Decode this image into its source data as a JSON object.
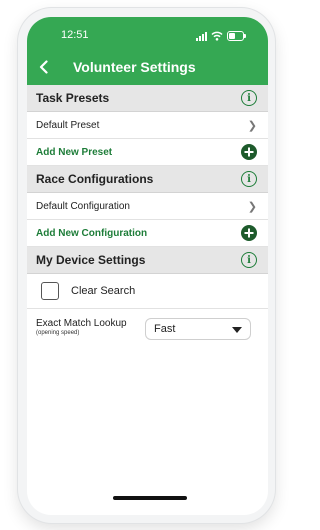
{
  "status_bar": {
    "time": "12:51"
  },
  "nav": {
    "title": "Volunteer Settings"
  },
  "task_presets": {
    "title": "Task Presets",
    "items": [
      {
        "label": "Default Preset"
      }
    ],
    "add_label": "Add New Preset"
  },
  "race_configurations": {
    "title": "Race Configurations",
    "items": [
      {
        "label": "Default Configuration"
      }
    ],
    "add_label": "Add New Configuration"
  },
  "device_settings": {
    "title": "My Device Settings",
    "clear_search": {
      "label": "Clear Search",
      "checked": false
    },
    "lookup": {
      "label": "Exact Match Lookup",
      "sublabel": "(opening speed)",
      "value": "Fast"
    }
  },
  "colors": {
    "header": "#35a853",
    "accent": "#1e7d39",
    "add_icon": "#1e5b2c"
  },
  "icons": {
    "back": "chevron-left-icon",
    "info": "info-icon",
    "add": "plus-circle-icon",
    "row": "chevron-right-icon",
    "dropdown": "caret-down-icon"
  }
}
